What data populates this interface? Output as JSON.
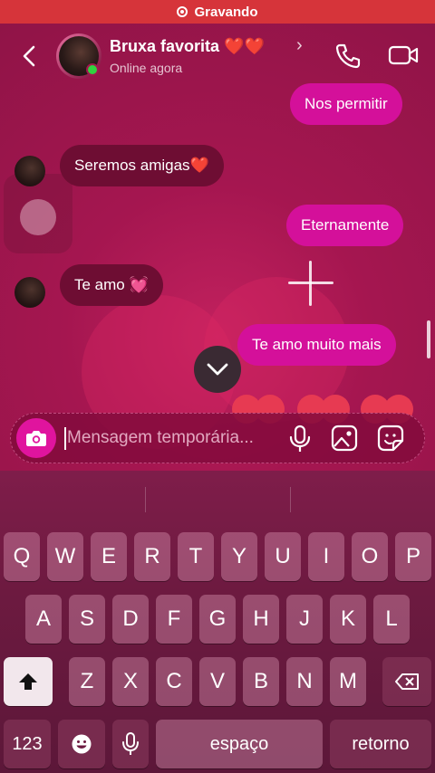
{
  "status_bar": {
    "recording_label": "Gravando"
  },
  "header": {
    "contact_name": "Bruxa favorita ❤️❤️",
    "status": "Online agora"
  },
  "messages": [
    {
      "direction": "outgoing",
      "text": "Nos permitir"
    },
    {
      "direction": "incoming",
      "text": "Seremos amigas❤️"
    },
    {
      "direction": "outgoing",
      "text": "Eternamente"
    },
    {
      "direction": "incoming",
      "text": "Te amo 💓"
    },
    {
      "direction": "outgoing",
      "text": "Te amo muito mais"
    }
  ],
  "composer": {
    "placeholder": "Mensagem temporária..."
  },
  "keyboard": {
    "row1": [
      "Q",
      "W",
      "E",
      "R",
      "T",
      "Y",
      "U",
      "I",
      "O",
      "P"
    ],
    "row2": [
      "A",
      "S",
      "D",
      "F",
      "G",
      "H",
      "J",
      "K",
      "L"
    ],
    "row3": [
      "Z",
      "X",
      "C",
      "V",
      "B",
      "N",
      "M"
    ],
    "numbers_label": "123",
    "space_label": "espaço",
    "return_label": "retorno"
  },
  "colors": {
    "outgoing_bubble": "#d4109a",
    "incoming_bubble": "#6e0d33",
    "recording_bar": "#d6343a",
    "online_indicator": "#31d23f"
  },
  "icons": [
    "record-icon",
    "back-arrow-icon",
    "phone-icon",
    "video-camera-icon",
    "chevron-right-icon",
    "chevron-down-icon",
    "camera-icon",
    "microphone-icon",
    "image-icon",
    "sticker-icon",
    "shift-icon",
    "backspace-icon",
    "emoji-icon",
    "dictation-icon"
  ]
}
